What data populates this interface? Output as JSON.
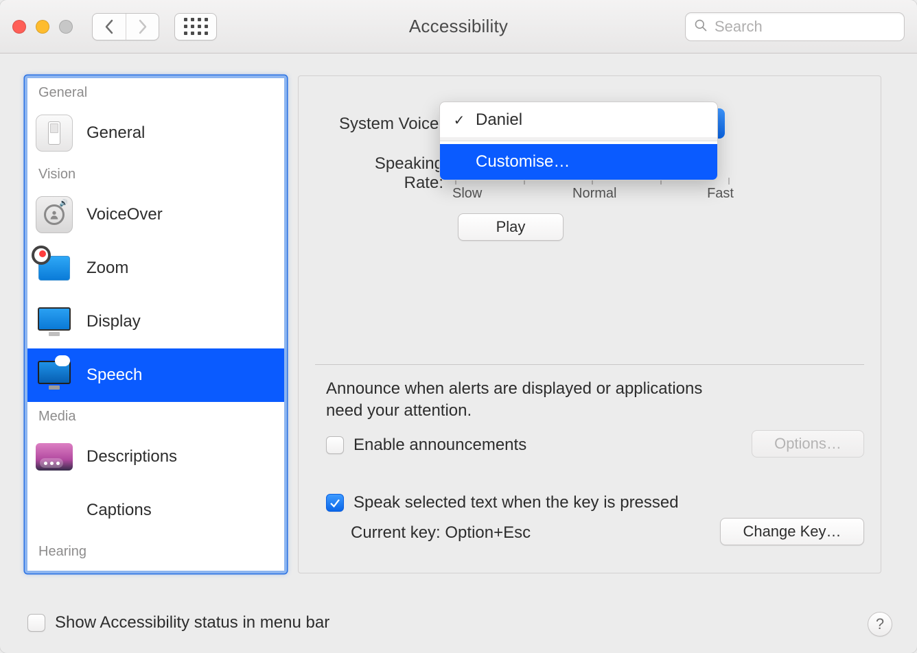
{
  "window": {
    "title": "Accessibility"
  },
  "search": {
    "placeholder": "Search"
  },
  "sidebar": {
    "sections": {
      "general": "General",
      "vision": "Vision",
      "media": "Media",
      "hearing": "Hearing"
    },
    "items": {
      "general": "General",
      "voiceover": "VoiceOver",
      "zoom": "Zoom",
      "display": "Display",
      "speech": "Speech",
      "descriptions": "Descriptions",
      "captions": "Captions"
    },
    "selected": "speech"
  },
  "speech": {
    "systemVoiceLabel": "System Voice:",
    "speakingRateLabel": "Speaking Rate:",
    "slider": {
      "slow": "Slow",
      "normal": "Normal",
      "fast": "Fast"
    },
    "playLabel": "Play",
    "announceText": "Announce when alerts are displayed or applications need your attention.",
    "enableAnnouncements": {
      "label": "Enable announcements",
      "checked": false
    },
    "optionsLabel": "Options…",
    "speakSelected": {
      "label": "Speak selected text when the key is pressed",
      "checked": true
    },
    "currentKey": "Current key: Option+Esc",
    "changeKeyLabel": "Change Key…"
  },
  "voiceMenu": {
    "selected": "Daniel",
    "customise": "Customise…"
  },
  "footer": {
    "showStatus": {
      "label": "Show Accessibility status in menu bar",
      "checked": false
    }
  }
}
